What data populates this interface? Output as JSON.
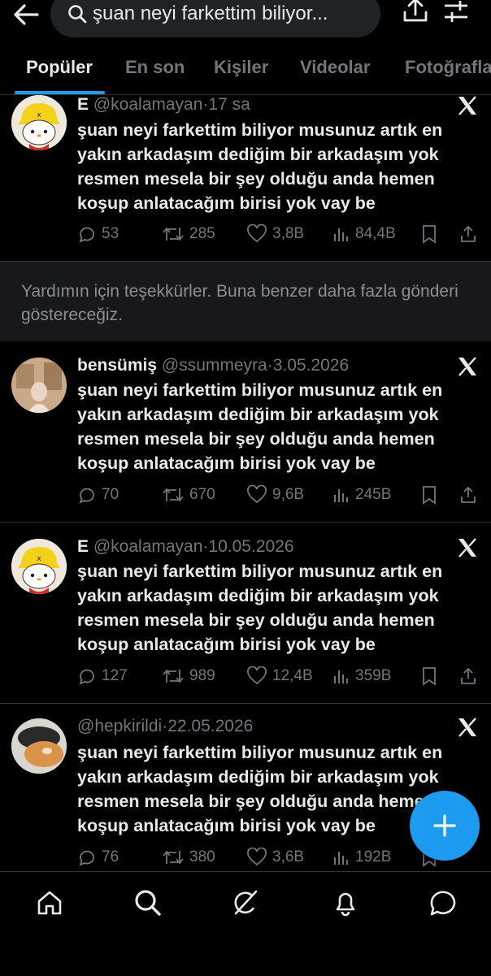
{
  "search": {
    "query": "şuan neyi farkettim biliyor..."
  },
  "tabs": [
    "Popüler",
    "En son",
    "Kişiler",
    "Videolar",
    "Fotoğrafla"
  ],
  "feedback": {
    "text": "Yardımın için teşekkürler. Buna benzer daha fazla gönderi göstereceğiz."
  },
  "tweets": [
    {
      "name": "E",
      "handle": "@koalamayan",
      "sep": "·",
      "time": "17 sa",
      "text": "şuan neyi farkettim biliyor musunuz artık en yakın arkadaşım dediğim bir arkadaşım yok resmen mesela bir şey olduğu anda hemen koşup anlatacağım birisi yok vay be",
      "replies": "53",
      "retweets": "285",
      "likes": "3,8B",
      "views": "84,4B"
    },
    {
      "name": "bensümiş",
      "handle": "@ssummeyra",
      "sep": "·",
      "time": "3.05.2026",
      "text": "şuan neyi farkettim biliyor musunuz artık en yakın arkadaşım dediğim bir arkadaşım yok resmen mesela bir şey olduğu anda hemen koşup anlatacağım birisi yok vay be",
      "replies": "70",
      "retweets": "670",
      "likes": "9,6B",
      "views": "245B"
    },
    {
      "name": "E",
      "handle": "@koalamayan",
      "sep": "·",
      "time": "10.05.2026",
      "text": "şuan neyi farkettim biliyor musunuz artık en yakın arkadaşım dediğim bir arkadaşım yok resmen mesela bir şey olduğu anda hemen koşup anlatacağım birisi yok vay be",
      "replies": "127",
      "retweets": "989",
      "likes": "12,4B",
      "views": "359B"
    },
    {
      "name": "",
      "handle": "@hepkirildi",
      "sep": "·",
      "time": "22.05.2026",
      "text": "şuan neyi farkettim biliyor musunuz artık en yakın arkadaşım dediğim bir arkadaşım yok resmen mesela bir şey olduğu anda hemen koşup anlatacağım birisi yok vay be",
      "replies": "76",
      "retweets": "380",
      "likes": "3,6B",
      "views": "192B"
    }
  ],
  "icons": {
    "topbar": [
      "back-arrow-icon",
      "search-icon",
      "share-icon",
      "filter-icon"
    ],
    "nav": [
      "home-icon",
      "search-icon",
      "grok-icon",
      "notifications-icon",
      "messages-icon"
    ],
    "accent": "#1d9bf0"
  }
}
